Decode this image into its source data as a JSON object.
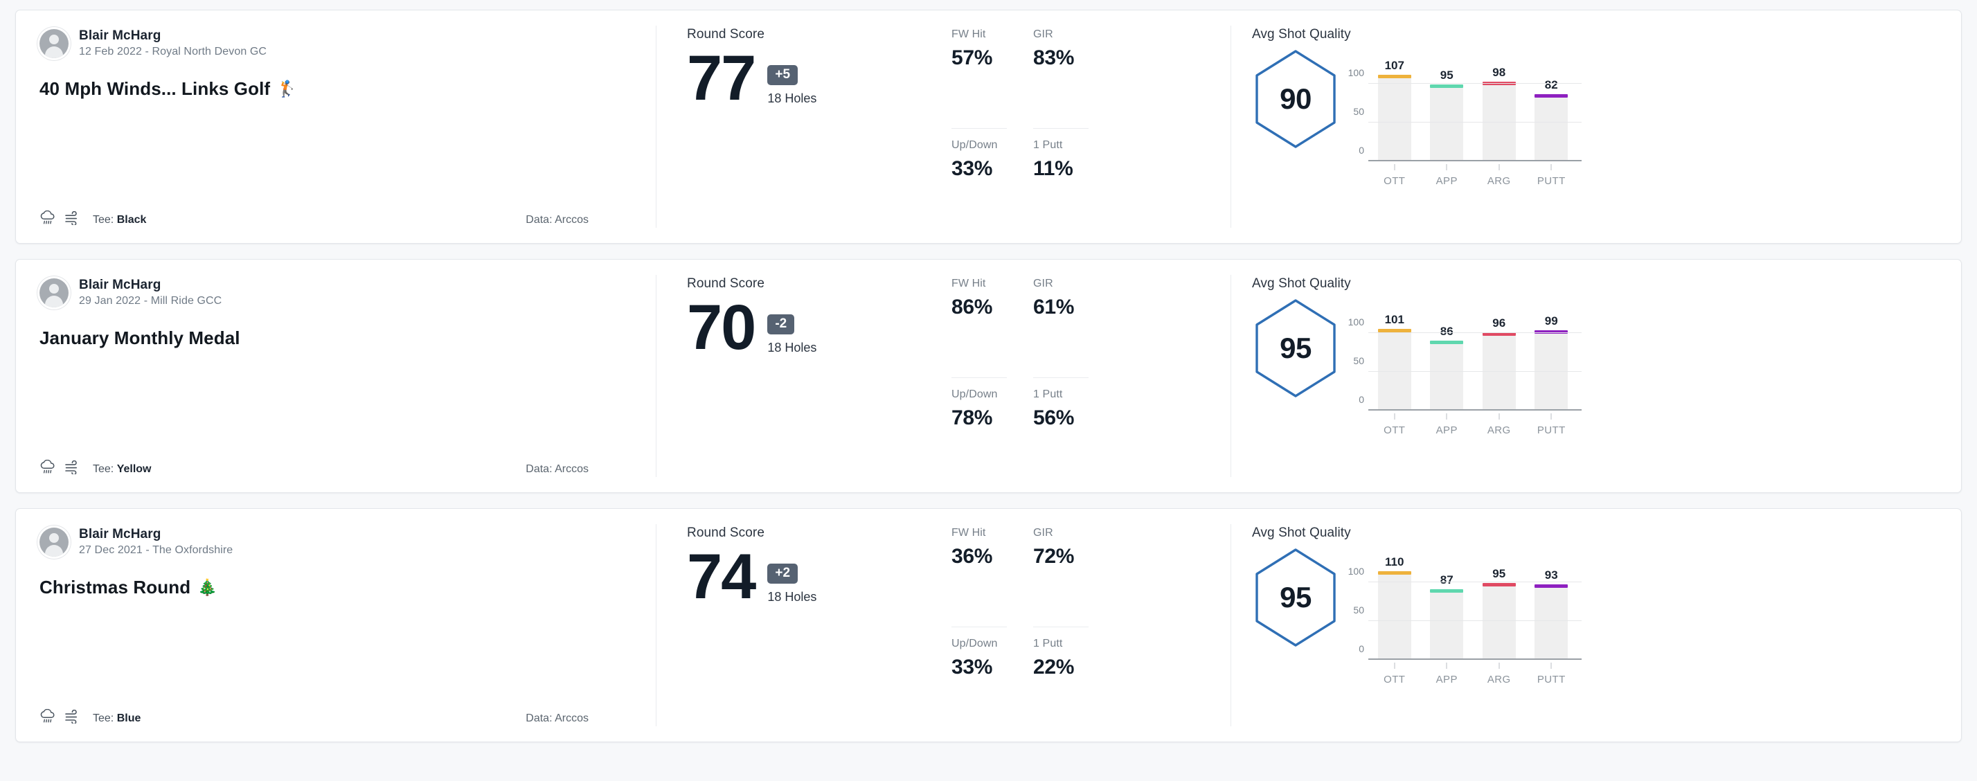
{
  "labels": {
    "round_score": "Round Score",
    "holes": "18 Holes",
    "avg_shot_quality": "Avg Shot Quality",
    "tee_prefix": "Tee:",
    "data_prefix": "Data:",
    "stat_fw": "FW Hit",
    "stat_gir": "GIR",
    "stat_updown": "Up/Down",
    "stat_1putt": "1 Putt"
  },
  "colors": {
    "ott": "#eeb23c",
    "app": "#5fd7ae",
    "arg": "#e04a63",
    "putt": "#8e20c0",
    "hexagon": "#2f6fb5",
    "to_par_badge": "#566272",
    "bar_track": "#efefef"
  },
  "chart_axis": {
    "categories": [
      "OTT",
      "APP",
      "ARG",
      "PUTT"
    ],
    "yticks": [
      "100",
      "50",
      "0"
    ],
    "ymax": 125,
    "ymin": 0
  },
  "rounds": [
    {
      "player": "Blair McHarg",
      "subtitle": "12 Feb 2022 - Royal North Devon GC",
      "title": "40 Mph Winds... Links Golf",
      "title_emoji": "🏌",
      "weather_icon": "rain-cloud-icon",
      "wind_icon": "wind-icon",
      "tee": "Black",
      "data_source": "Arccos",
      "score": "77",
      "to_par": "+5",
      "holes": "18 Holes",
      "stats": {
        "fw_hit": "57%",
        "gir": "83%",
        "up_down": "33%",
        "one_putt": "11%"
      },
      "avg_shot_quality": "90",
      "chart_data": {
        "type": "bar",
        "title": "Avg Shot Quality",
        "categories": [
          "OTT",
          "APP",
          "ARG",
          "PUTT"
        ],
        "values": [
          107,
          95,
          98,
          82
        ],
        "colors": [
          "#eeb23c",
          "#5fd7ae",
          "#e04a63",
          "#8e20c0"
        ],
        "ylim": [
          0,
          125
        ],
        "yticks": [
          0,
          50,
          100
        ],
        "grid": true,
        "legend": "none"
      }
    },
    {
      "player": "Blair McHarg",
      "subtitle": "29 Jan 2022 - Mill Ride GCC",
      "title": "January Monthly Medal",
      "title_emoji": "",
      "weather_icon": "rain-cloud-icon",
      "wind_icon": "wind-icon",
      "tee": "Yellow",
      "data_source": "Arccos",
      "score": "70",
      "to_par": "-2",
      "holes": "18 Holes",
      "stats": {
        "fw_hit": "86%",
        "gir": "61%",
        "up_down": "78%",
        "one_putt": "56%"
      },
      "avg_shot_quality": "95",
      "chart_data": {
        "type": "bar",
        "title": "Avg Shot Quality",
        "categories": [
          "OTT",
          "APP",
          "ARG",
          "PUTT"
        ],
        "values": [
          101,
          86,
          96,
          99
        ],
        "colors": [
          "#eeb23c",
          "#5fd7ae",
          "#e04a63",
          "#8e20c0"
        ],
        "ylim": [
          0,
          125
        ],
        "yticks": [
          0,
          50,
          100
        ],
        "grid": true,
        "legend": "none"
      }
    },
    {
      "player": "Blair McHarg",
      "subtitle": "27 Dec 2021 - The Oxfordshire",
      "title": "Christmas Round",
      "title_emoji": "🎄",
      "weather_icon": "rain-cloud-icon",
      "wind_icon": "wind-icon",
      "tee": "Blue",
      "data_source": "Arccos",
      "score": "74",
      "to_par": "+2",
      "holes": "18 Holes",
      "stats": {
        "fw_hit": "36%",
        "gir": "72%",
        "up_down": "33%",
        "one_putt": "22%"
      },
      "avg_shot_quality": "95",
      "chart_data": {
        "type": "bar",
        "title": "Avg Shot Quality",
        "categories": [
          "OTT",
          "APP",
          "ARG",
          "PUTT"
        ],
        "values": [
          110,
          87,
          95,
          93
        ],
        "colors": [
          "#eeb23c",
          "#5fd7ae",
          "#e04a63",
          "#8e20c0"
        ],
        "ylim": [
          0,
          125
        ],
        "yticks": [
          0,
          50,
          100
        ],
        "grid": true,
        "legend": "none"
      }
    }
  ]
}
